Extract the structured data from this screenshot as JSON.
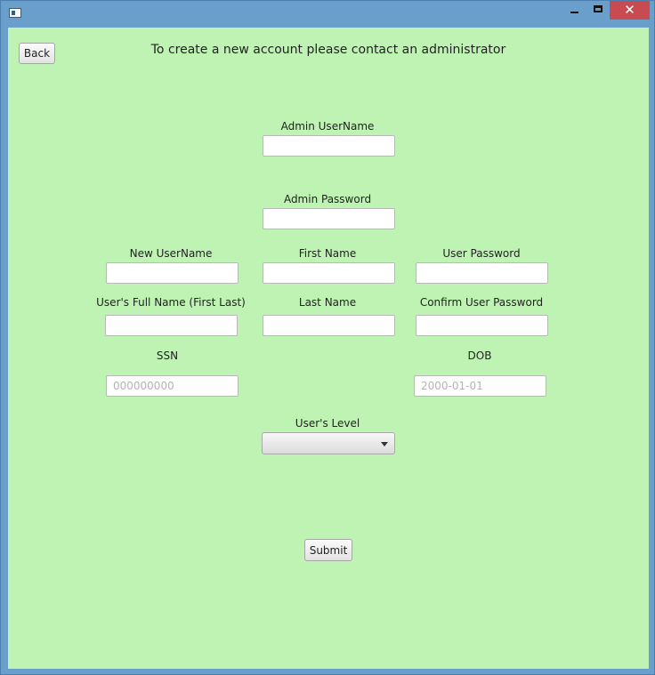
{
  "window": {
    "close_glyph": "✕"
  },
  "header": {
    "back_label": "Back",
    "message": "To create a new account please contact an administrator"
  },
  "form": {
    "admin_username": {
      "label": "Admin UserName",
      "value": "",
      "placeholder": ""
    },
    "admin_password": {
      "label": "Admin Password",
      "value": "",
      "placeholder": ""
    },
    "new_username": {
      "label": "New UserName",
      "value": "",
      "placeholder": ""
    },
    "first_name": {
      "label": "First Name",
      "value": "",
      "placeholder": ""
    },
    "user_password": {
      "label": "User Password",
      "value": "",
      "placeholder": ""
    },
    "full_name": {
      "label": "User's Full Name (First Last)",
      "value": "",
      "placeholder": ""
    },
    "last_name": {
      "label": "Last Name",
      "value": "",
      "placeholder": ""
    },
    "confirm_password": {
      "label": "Confirm User Password",
      "value": "",
      "placeholder": ""
    },
    "ssn": {
      "label": "SSN",
      "value": "",
      "placeholder": "000000000"
    },
    "dob": {
      "label": "DOB",
      "value": "",
      "placeholder": "2000-01-01"
    },
    "user_level": {
      "label": "User's Level",
      "selected": ""
    },
    "submit_label": "Submit"
  }
}
